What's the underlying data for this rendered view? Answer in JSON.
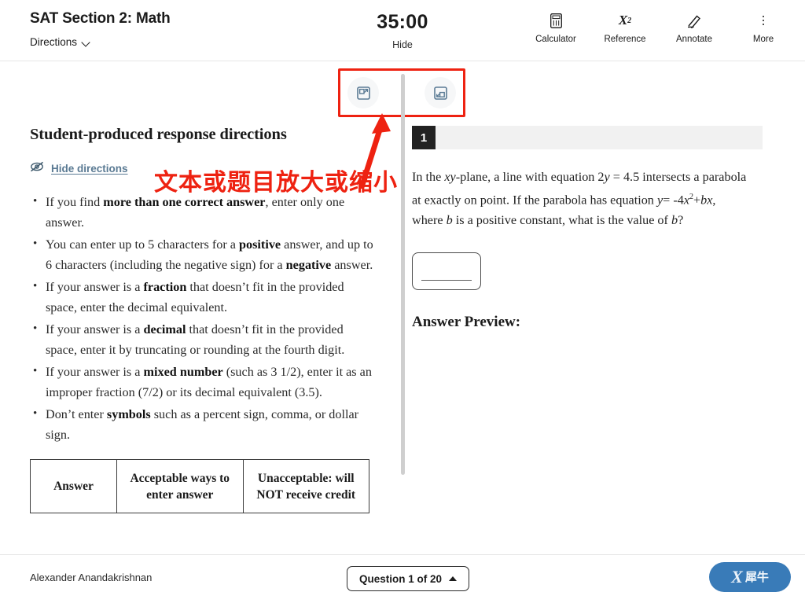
{
  "header": {
    "exam_title": "SAT Section 2: Math",
    "directions_label": "Directions",
    "timer": "35:00",
    "hide_timer_label": "Hide",
    "tools": [
      {
        "label": "Calculator",
        "icon": "calculator-icon"
      },
      {
        "label": "Reference",
        "icon": "reference-icon"
      },
      {
        "label": "Annotate",
        "icon": "annotate-icon"
      },
      {
        "label": "More",
        "icon": "more-icon"
      }
    ]
  },
  "zoom_controls": {
    "expand_label": "expand-panel-icon",
    "collapse_label": "collapse-panel-icon"
  },
  "left_panel": {
    "heading": "Student-produced response directions",
    "hide_directions_label": "Hide directions",
    "bullets": [
      "If you find <b>more than one correct answer</b>, enter only one answer.",
      "You can enter up to 5 characters for a <b>positive</b> answer, and up to 6 characters (including the negative sign) for a <b>negative</b> answer.",
      "If your answer is a <b>fraction</b> that doesn’t fit in the provided space, enter the decimal equivalent.",
      "If your answer is a <b>decimal</b> that doesn’t fit in the provided space, enter it by truncating or rounding at the fourth digit.",
      "If your answer is a <b>mixed number</b> (such as 3 1/2), enter it as an improper fraction (7/2) or its decimal equivalent (3.5).",
      "Don’t enter <b>symbols</b> such as a percent sign, comma, or dollar sign."
    ],
    "table": {
      "headers": [
        "Answer",
        "Acceptable ways to enter answer",
        "Unacceptable: will NOT receive credit"
      ]
    }
  },
  "right_panel": {
    "question_number": "1",
    "question_html": "In the <i>xy</i>-plane, a line with equation 2<i>y</i> = 4.5 intersects a parabola at exactly on point. If the parabola has equation <i>y</i>= -4<i>x</i><sup>2</sup>+<i>bx</i>, where <i>b</i> is a positive constant, what is the value of <i>b</i>?",
    "answer_value": "",
    "answer_preview_label": "Answer Preview:"
  },
  "annotations": {
    "chinese_note": "文本或题目放大或缩小",
    "highlight_color": "#ee2211"
  },
  "footer": {
    "student_name": "Alexander Anandakrishnan",
    "question_nav_label": "Question 1 of 20",
    "watermark_x": "X",
    "watermark_cn": "犀牛"
  }
}
